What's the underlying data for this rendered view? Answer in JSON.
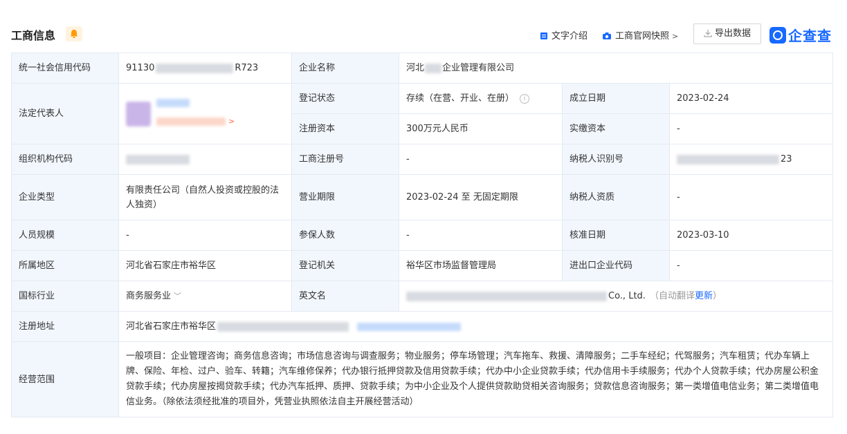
{
  "header": {
    "title": "工商信息",
    "text_intro": "文字介绍",
    "website_snapshot": "工商官网快照",
    "export": "导出数据",
    "brand": "企查查"
  },
  "rows": {
    "credit_code_label": "统一社会信用代码",
    "credit_code_value_start": "91130",
    "credit_code_value_end": "R723",
    "company_name_label": "企业名称",
    "company_name_start": "河北",
    "company_name_end": "企业管理有限公司",
    "legal_rep_label": "法定代表人",
    "reg_status_label": "登记状态",
    "reg_status_value": "存续（在营、开业、在册）",
    "founded_label": "成立日期",
    "founded_value": "2023-02-24",
    "reg_capital_label": "注册资本",
    "reg_capital_value": "300万元人民币",
    "paid_capital_label": "实缴资本",
    "paid_capital_value": "-",
    "org_code_label": "组织机构代码",
    "biz_reg_no_label": "工商注册号",
    "biz_reg_no_value": "-",
    "tax_id_label": "纳税人识别号",
    "tax_id_end": "23",
    "company_type_label": "企业类型",
    "company_type_value": "有限责任公司（自然人投资或控股的法人独资）",
    "biz_term_label": "营业期限",
    "biz_term_value": "2023-02-24 至 无固定期限",
    "taxpayer_qual_label": "纳税人资质",
    "taxpayer_qual_value": "-",
    "staff_size_label": "人员规模",
    "staff_size_value": "-",
    "insured_label": "参保人数",
    "insured_value": "-",
    "approval_date_label": "核准日期",
    "approval_date_value": "2023-03-10",
    "region_label": "所属地区",
    "region_value": "河北省石家庄市裕华区",
    "reg_authority_label": "登记机关",
    "reg_authority_value": "裕华区市场监督管理局",
    "import_export_label": "进出口企业代码",
    "import_export_value": "-",
    "industry_label": "国标行业",
    "industry_value": "商务服务业",
    "english_name_label": "英文名",
    "english_name_end": "Co., Ltd.",
    "auto_translate": "（自动翻译",
    "update": "更新",
    "close_paren": "）",
    "address_label": "注册地址",
    "address_start": "河北省石家庄市裕华区",
    "scope_label": "经营范围",
    "scope_value": "一般项目：企业管理咨询；商务信息咨询；市场信息咨询与调查服务；物业服务；停车场管理；汽车拖车、救援、清障服务；二手车经纪；代驾服务；汽车租赁；代办车辆上牌、保险、年检、过户、验车、转籍；汽车维修保养；代办银行抵押贷款及信用贷款手续；代办中小企业贷款手续；代办信用卡手续服务；代办个人贷款手续；代办房屋公积金贷款手续；代办房屋按揭贷款手续；代办汽车抵押、质押、贷款手续；为中小企业及个人提供贷款助贷相关咨询服务；贷款信息咨询服务；第一类增值电信业务；第二类增值电信业务。（除依法须经批准的项目外，凭营业执照依法自主开展经营活动）"
  }
}
